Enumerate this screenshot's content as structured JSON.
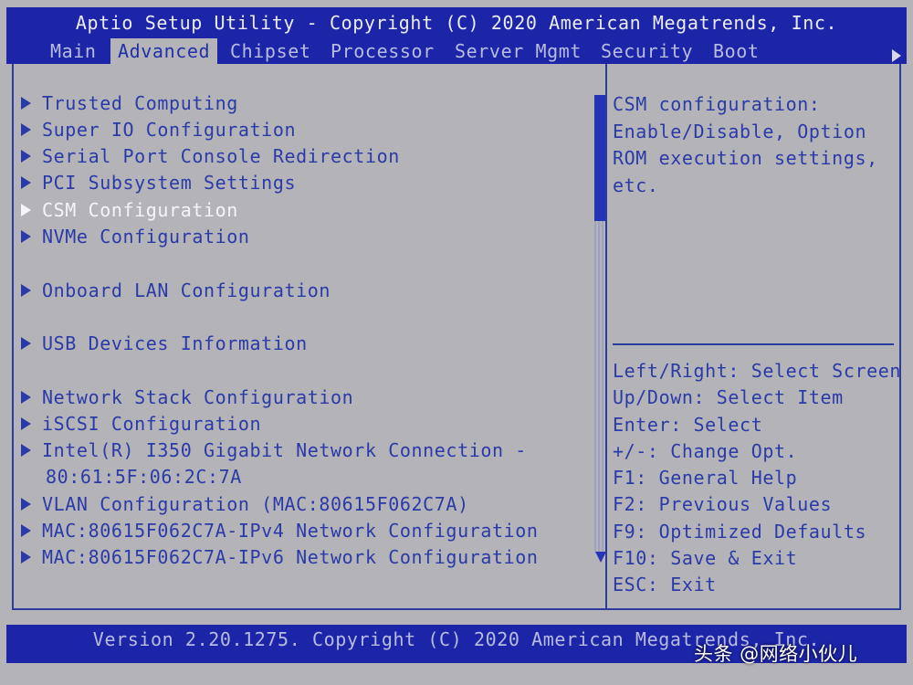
{
  "header": {
    "title": "Aptio Setup Utility - Copyright (C) 2020 American Megatrends, Inc.",
    "tabs": [
      {
        "label": "Main",
        "active": false
      },
      {
        "label": "Advanced",
        "active": true
      },
      {
        "label": "Chipset",
        "active": false
      },
      {
        "label": "Processor",
        "active": false
      },
      {
        "label": "Server Mgmt",
        "active": false
      },
      {
        "label": "Security",
        "active": false
      },
      {
        "label": "Boot",
        "active": false
      }
    ],
    "more_tabs_icon": "triangle-right-icon"
  },
  "menu": {
    "items": [
      {
        "label": "Trusted Computing"
      },
      {
        "label": "Super IO Configuration"
      },
      {
        "label": "Serial Port Console Redirection"
      },
      {
        "label": "PCI Subsystem Settings"
      },
      {
        "label": "CSM Configuration",
        "selected": true
      },
      {
        "label": "NVMe Configuration"
      },
      {
        "label": "Onboard LAN Configuration"
      },
      {
        "label": "USB Devices Information"
      },
      {
        "label": "Network Stack Configuration"
      },
      {
        "label": "iSCSI Configuration"
      },
      {
        "label": "Intel(R) I350 Gigabit Network Connection -"
      },
      {
        "label": "VLAN Configuration (MAC:80615F062C7A)"
      },
      {
        "label": "MAC:80615F062C7A-IPv4 Network Configuration"
      },
      {
        "label": "MAC:80615F062C7A-IPv6 Network Configuration"
      }
    ],
    "intel_continuation": "80:61:5F:06:2C:7A"
  },
  "help": {
    "description": "CSM configuration:\nEnable/Disable, Option\nROM execution settings,\netc.",
    "keys": [
      "Left/Right: Select Screen",
      "Up/Down: Select Item",
      "Enter: Select",
      "+/-: Change Opt.",
      "F1: General Help",
      "F2: Previous Values",
      "F9: Optimized Defaults",
      "F10: Save & Exit",
      "ESC: Exit"
    ]
  },
  "footer": {
    "version": "Version 2.20.1275. Copyright (C) 2020 American Megatrends, Inc."
  },
  "watermark": {
    "text": "头条 @网络小伙儿"
  },
  "colors": {
    "header_bg": "#1c24a8",
    "panel_bg": "#b4b4b8",
    "text_blue": "#2a3aa8",
    "selected_text": "#f4f4fa"
  }
}
